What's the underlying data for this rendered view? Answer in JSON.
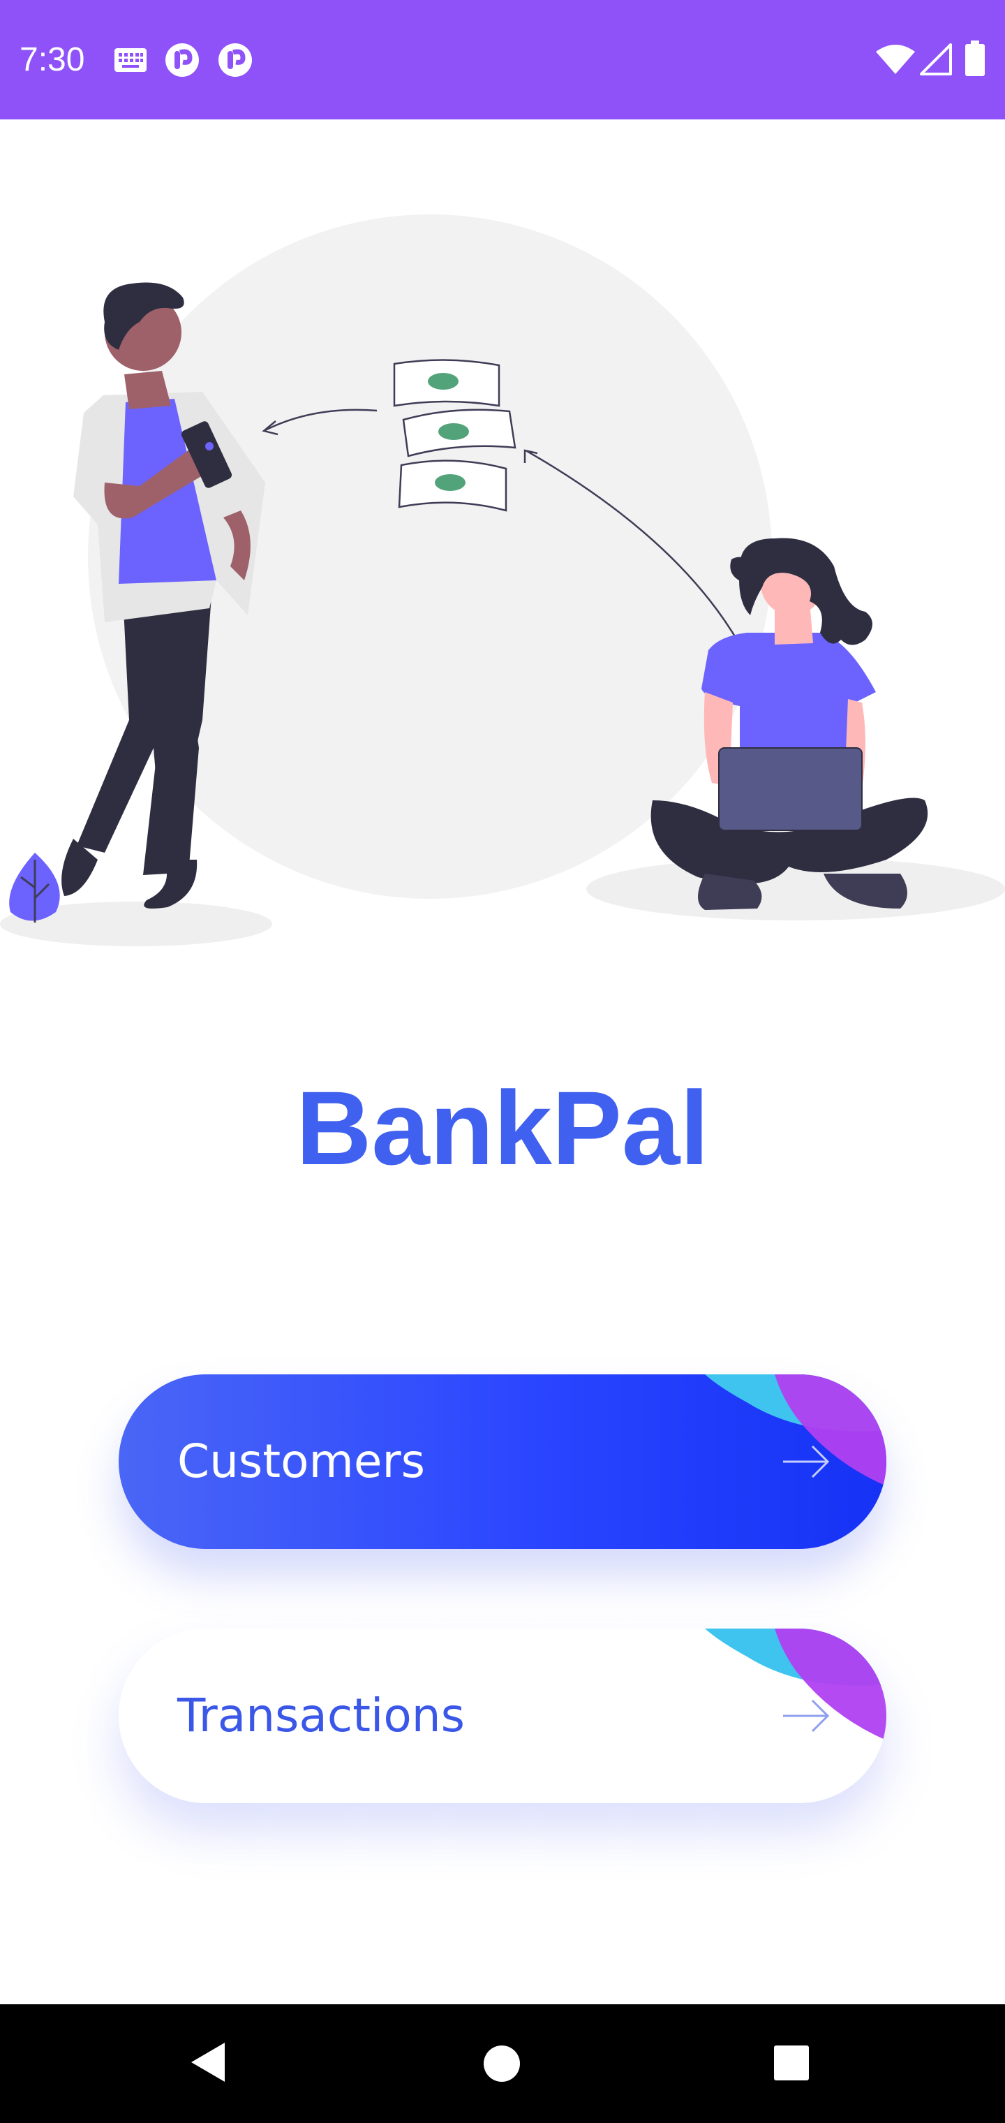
{
  "status_bar": {
    "time": "7:30",
    "background_color": "#8f52f8",
    "left_icons": [
      "keyboard-icon",
      "app-notification-icon",
      "app-notification-icon"
    ],
    "right_icons": [
      "wifi-icon",
      "cellular-signal-icon",
      "battery-icon"
    ]
  },
  "hero": {
    "illustration": "money-transfer-illustration"
  },
  "app": {
    "title": "BankPal",
    "title_color": "#4060f0"
  },
  "buttons": {
    "customers_label": "Customers",
    "transactions_label": "Transactions",
    "arrow_icon": "arrow-right-icon"
  },
  "nav_bar": {
    "keys": [
      "back-icon",
      "home-icon",
      "recents-icon"
    ]
  },
  "colors": {
    "accent": "#4a66f6",
    "accent_dark": "#1532f5",
    "corner_cyan": "#3fc4f0",
    "corner_purple": "#b040f0"
  }
}
